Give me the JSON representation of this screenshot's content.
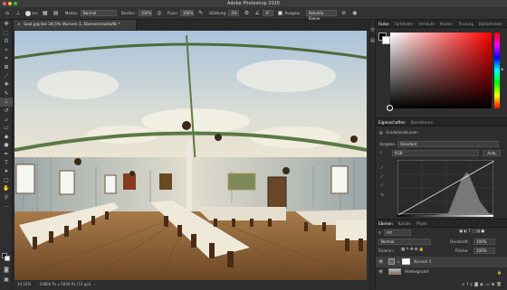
{
  "window": {
    "title": "Adobe Photoshop 2020"
  },
  "options_bar": {
    "mode_label": "Modus:",
    "mode_value": "Normal",
    "opacity_label": "Deckkr.:",
    "opacity_value": "100%",
    "flow_label": "Fluss:",
    "flow_value": "100%",
    "smoothing_label": "Glättung:",
    "smoothing_value": "0%",
    "angle_value": "0°",
    "sample_checkbox_label": "Ausgew.",
    "sample_label": "Aktuelle Ebene",
    "brush_size": "500"
  },
  "document": {
    "tab_label": "Saal.jpg bei 34,5% (Kurven 1, Ebenenmaske/8) *",
    "zoom": "34,53%",
    "doc_info": "10800 Px x 5000 Px (72 ppi)"
  },
  "tools": [
    "move",
    "marquee",
    "lasso",
    "quick-select",
    "crop",
    "frame",
    "eyedropper",
    "healing",
    "brush",
    "clone",
    "history",
    "eraser",
    "gradient",
    "blur",
    "dodge",
    "pen",
    "type",
    "path-select",
    "rectangle",
    "hand",
    "zoom",
    "more"
  ],
  "color_panel": {
    "tabs": [
      "Farbe",
      "Farbfelder",
      "Verläufe",
      "Muster",
      "Training",
      "Bibliotheken"
    ],
    "active_tab": "Farbe",
    "hue_color": "#ff0000"
  },
  "properties_panel": {
    "tabs": [
      "Eigenschaften",
      "Korrekturen"
    ],
    "active_tab": "Eigenschaften",
    "title": "Gradationskurven",
    "preset_label": "Vorgabe:",
    "preset_value": "Standard",
    "channel_value": "RGB",
    "auto_label": "Auto"
  },
  "layers_panel": {
    "tabs": [
      "Ebenen",
      "Kanäle",
      "Pfade"
    ],
    "active_tab": "Ebenen",
    "filter_value": "Art",
    "blend_mode": "Normal",
    "opacity_label": "Deckkraft:",
    "opacity_value": "100%",
    "lock_label": "Fixieren:",
    "fill_label": "Fläche:",
    "fill_value": "100%",
    "layers": [
      {
        "name": "Kurven 1",
        "selected": true
      },
      {
        "name": "Hintergrund",
        "selected": false
      }
    ]
  }
}
